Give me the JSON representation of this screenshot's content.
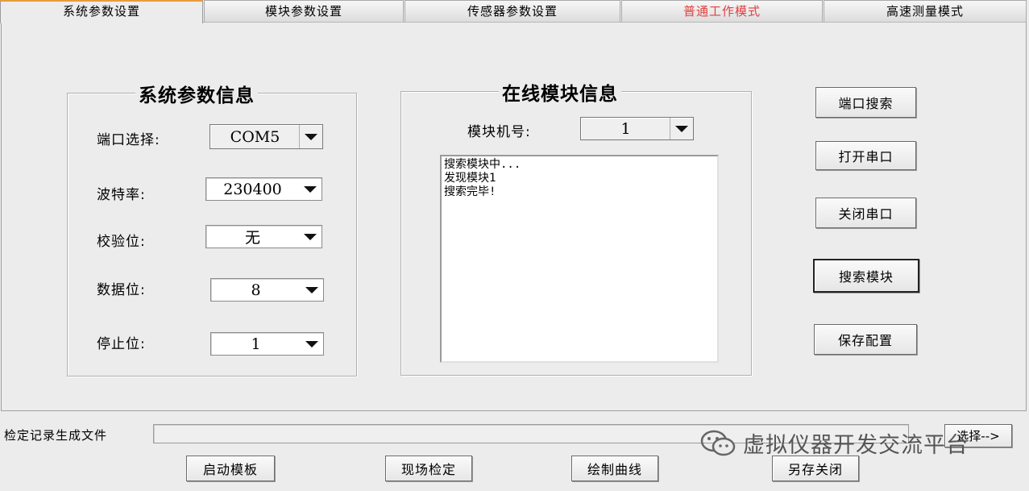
{
  "tabs": [
    {
      "label": "系统参数设置",
      "active": true
    },
    {
      "label": "模块参数设置"
    },
    {
      "label": "传感器参数设置"
    },
    {
      "label": "普通工作模式",
      "color": "#e04040"
    },
    {
      "label": "高速测量模式"
    }
  ],
  "system_group": {
    "title": "系统参数信息",
    "fields": [
      {
        "label": "端口选择:",
        "value": "COM5"
      },
      {
        "label": "波特率:",
        "value": "230400"
      },
      {
        "label": "校验位:",
        "value": "无"
      },
      {
        "label": "数据位:",
        "value": "8"
      },
      {
        "label": "停止位:",
        "value": "1"
      }
    ]
  },
  "online_group": {
    "title": "在线模块信息",
    "module_label": "模块机号:",
    "module_value": "1",
    "log_lines": [
      "搜索模块中...",
      "发现模块1",
      "搜索完毕!"
    ]
  },
  "side_buttons": {
    "port_search": "端口搜索",
    "open_port": "打开串口",
    "close_port": "关闭串口",
    "search_module": "搜索模块",
    "save_config": "保存配置"
  },
  "bottom": {
    "file_label": "检定记录生成文件",
    "file_value": "",
    "choose_button": "选择-->",
    "start_template": "启动模板",
    "field_check": "现场检定",
    "draw_curve": "绘制曲线",
    "save_close": "另存关闭"
  },
  "watermark": {
    "text": "虚拟仪器开发交流平台",
    "icon": "wechat-icon"
  }
}
